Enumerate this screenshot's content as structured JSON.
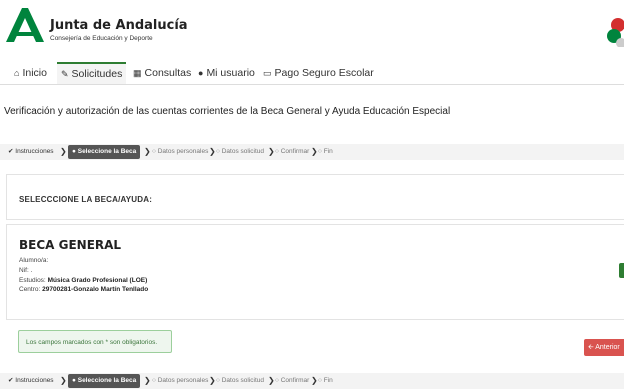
{
  "header": {
    "title": "Junta de Andalucía",
    "subtitle": "Consejería de Educación y Deporte"
  },
  "nav": {
    "items": [
      {
        "label": "Inicio",
        "icon": "home-icon"
      },
      {
        "label": "Solicitudes",
        "icon": "pencil-icon",
        "active": true
      },
      {
        "label": "Consultas",
        "icon": "table-icon"
      },
      {
        "label": "Mi usuario",
        "icon": "user-icon"
      },
      {
        "label": "Pago Seguro Escolar",
        "icon": "credit-card-icon"
      }
    ]
  },
  "page_title": "Verificación y autorización de las cuentas corrientes de la Beca General y Ayuda Educación Especial",
  "steps": [
    {
      "label": "Instrucciones",
      "state": "done"
    },
    {
      "label": "Seleccione la Beca",
      "state": "current"
    },
    {
      "label": "Datos personales",
      "state": "pending"
    },
    {
      "label": "Datos solicitud",
      "state": "pending"
    },
    {
      "label": "Confirmar",
      "state": "pending"
    },
    {
      "label": "Fin",
      "state": "pending"
    }
  ],
  "select_section": {
    "label": "SELECCCIONE LA BECA/AYUDA:"
  },
  "beca": {
    "title": "BECA GENERAL",
    "alumno_label": "Alumno/a:",
    "nif_label": "Nif:",
    "nif_value": ".",
    "estudios_label": "Estudios:",
    "estudios_value": "Música Grado Profesional (LOE)",
    "centro_label": "Centro:",
    "centro_value": "29700281-Gonzalo Martín Tenllado"
  },
  "alert": {
    "text": "Los campos marcados con * son obligatorios."
  },
  "buttons": {
    "prev_label": "Anterior"
  },
  "colors": {
    "brand_green": "#2e7d32",
    "danger": "#d9534f"
  }
}
